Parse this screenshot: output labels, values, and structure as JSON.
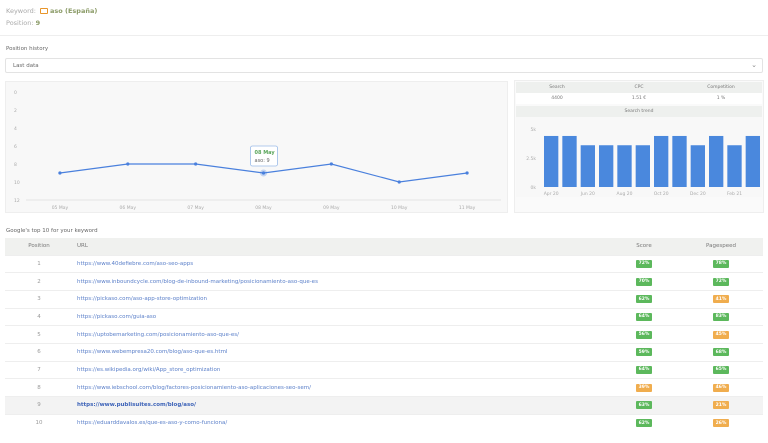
{
  "header": {
    "keyword_label": "Keyword:",
    "keyword": "aso (España)",
    "position_label": "Position:",
    "position": "9"
  },
  "history": {
    "label": "Position history",
    "select_value": "Last data"
  },
  "chart_data": [
    {
      "type": "line",
      "title": "Position history",
      "x": [
        "05 May",
        "06 May",
        "07 May",
        "08 May",
        "09 May",
        "10 May",
        "11 May"
      ],
      "values": [
        9,
        8,
        8,
        9,
        8,
        10,
        9
      ],
      "ylim": [
        0,
        12
      ],
      "y_ticks": [
        "0",
        "2",
        "4",
        "6",
        "8",
        "10",
        "12"
      ],
      "inverted_y": true,
      "tooltip": {
        "date": "08 May",
        "text": "aso: 9"
      },
      "color": "#4a80dd"
    },
    {
      "type": "bar",
      "title": "Search trend",
      "x": [
        "Apr 20",
        "May 20",
        "Jun 20",
        "Jul 20",
        "Aug 20",
        "Sep 20",
        "Oct 20",
        "Nov 20",
        "Dec 20",
        "Jan 21",
        "Feb 21",
        "Mar 21"
      ],
      "x_tick_labels": [
        "Apr 20",
        "Jun 20",
        "Aug 20",
        "Oct 20",
        "Dec 20",
        "Feb 21"
      ],
      "values": [
        4400,
        4400,
        3600,
        3600,
        3600,
        3600,
        4400,
        4400,
        3600,
        4400,
        3600,
        4400
      ],
      "ylim": [
        0,
        5000
      ],
      "y_ticks": [
        "0k",
        "2.5k",
        "5k"
      ],
      "color": "#4a88dd"
    }
  ],
  "kpi": {
    "headers": [
      "Search",
      "CPC",
      "Competition"
    ],
    "values": [
      "4400",
      "1.51 €",
      "1 %"
    ],
    "trend_title": "Search trend"
  },
  "top10": {
    "label": "Google's top 10 for your keyword",
    "columns": [
      "Position",
      "URL",
      "Score",
      "Pagespeed"
    ],
    "rows": [
      {
        "pos": "1",
        "url": "https://www.40defiebre.com/aso-seo-apps",
        "score": "72%",
        "speed": "78%"
      },
      {
        "pos": "2",
        "url": "https://www.inboundcycle.com/blog-de-inbound-marketing/posicionamiento-aso-que-es",
        "score": "70%",
        "speed": "72%"
      },
      {
        "pos": "3",
        "url": "https://pickaso.com/aso-app-store-optimization",
        "score": "62%",
        "speed": "41%"
      },
      {
        "pos": "4",
        "url": "https://pickaso.com/guia-aso",
        "score": "64%",
        "speed": "83%"
      },
      {
        "pos": "5",
        "url": "https://uptobemarketing.com/posicionamiento-aso-que-es/",
        "score": "56%",
        "speed": "45%"
      },
      {
        "pos": "6",
        "url": "https://www.webempresa20.com/blog/aso-que-es.html",
        "score": "59%",
        "speed": "68%"
      },
      {
        "pos": "7",
        "url": "https://es.wikipedia.org/wiki/App_store_optimization",
        "score": "64%",
        "speed": "65%"
      },
      {
        "pos": "8",
        "url": "https://www.iebschool.com/blog/factores-posicionamiento-aso-aplicaciones-seo-sem/",
        "score": "39%",
        "speed": "46%"
      },
      {
        "pos": "9",
        "url": "https://www.publisuites.com/blog/aso/",
        "score": "63%",
        "speed": "21%"
      },
      {
        "pos": "10",
        "url": "https://eduarddavalos.es/que-es-aso-y-como-funciona/",
        "score": "62%",
        "speed": "26%"
      }
    ]
  },
  "colors": {
    "good": "#5cb85c",
    "warn": "#f0ad4e",
    "highlight_row": "9"
  }
}
